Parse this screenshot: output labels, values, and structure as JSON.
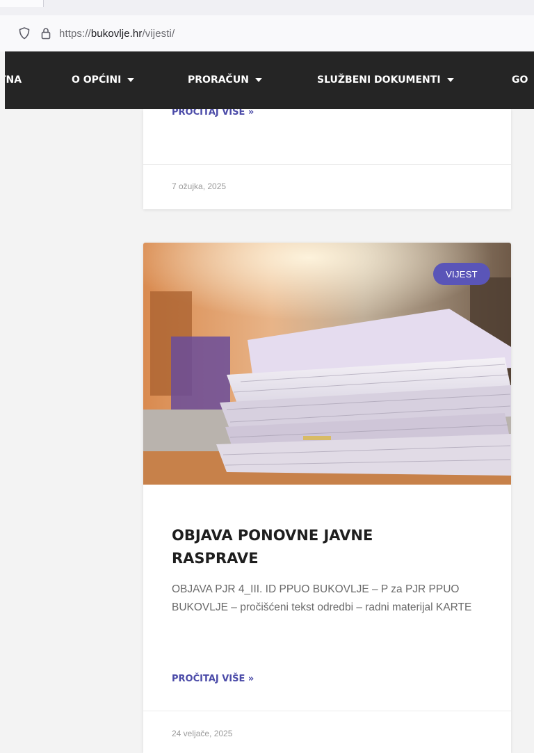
{
  "browser": {
    "url_scheme": "https://",
    "url_host": "bukovlje.hr",
    "url_path": "/vijesti/",
    "icons": [
      "shield-icon",
      "lock-icon"
    ]
  },
  "nav": {
    "items": [
      {
        "label": "TNA",
        "caret": false
      },
      {
        "label": "O OPĆINI",
        "caret": true
      },
      {
        "label": "PRORAČUN",
        "caret": true
      },
      {
        "label": "SLUŽBENI DOKUMENTI",
        "caret": true
      },
      {
        "label": "GO",
        "caret": false
      }
    ]
  },
  "posts": [
    {
      "read_more": "PROČITAJ VIŠE »",
      "date": "7 ožujka, 2025"
    },
    {
      "badge": "VIJEST",
      "title": "OBJAVA PONOVNE JAVNE RASPRAVE",
      "excerpt": "OBJAVA PJR 4_III. ID PPUO BUKOVLJE – P za PJR PPUO BUKOVLJE – pročišćeni tekst odredbi – radni materijal KARTE",
      "read_more": "PROČITAJ VIŠE »",
      "date": "24 veljače, 2025",
      "image_icon": "document-stack-photo"
    }
  ],
  "colors": {
    "nav_bg": "#252525",
    "accent": "#4b4ba8",
    "badge_bg": "#5a55b8",
    "page_bg": "#f3f3f3"
  }
}
